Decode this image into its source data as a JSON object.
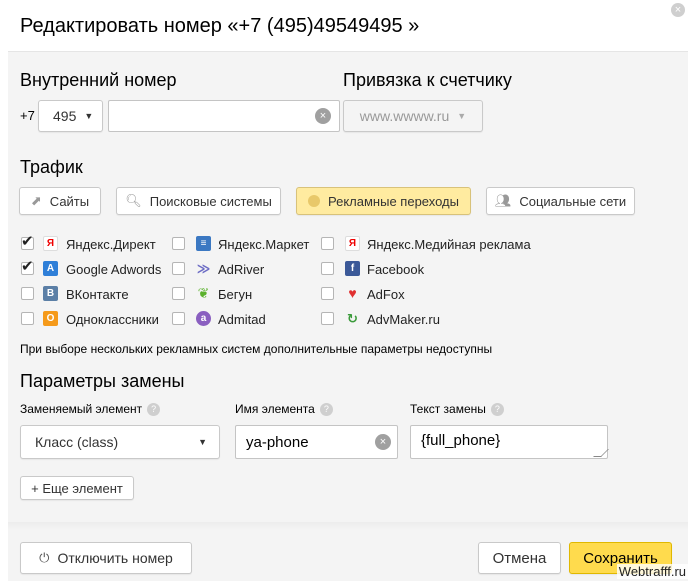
{
  "dialog": {
    "title": "Редактировать номер  «+7 (495)49549495 »",
    "close_icon": "×"
  },
  "internal_number": {
    "heading": "Внутренний номер",
    "country_code": "+7",
    "area_code": "495",
    "number_value": ""
  },
  "counter_binding": {
    "heading": "Привязка к счетчику",
    "site": "www.wwww.ru"
  },
  "traffic": {
    "heading": "Трафик",
    "buttons": [
      {
        "label": "Сайты",
        "icon": "arrow-icon"
      },
      {
        "label": "Поисковые системы",
        "icon": "search-icon"
      },
      {
        "label": "Рекламные переходы",
        "icon": "coin-icon"
      },
      {
        "label": "Социальные сети",
        "icon": "people-icon"
      }
    ],
    "active": "Рекламные переходы",
    "ad_systems": [
      {
        "label": "Яндекс.Директ",
        "checked": true,
        "icon": "yandex-icon",
        "color": "#ffffff"
      },
      {
        "label": "Google Adwords",
        "checked": true,
        "icon": "google-adwords-icon",
        "color": "#2f7fd8"
      },
      {
        "label": "ВКонтакте",
        "checked": false,
        "icon": "vk-icon",
        "color": "#5b7fa6"
      },
      {
        "label": "Одноклассники",
        "checked": false,
        "icon": "odnoklassniki-icon",
        "color": "#f59a1a"
      },
      {
        "label": "Яндекс.Маркет",
        "checked": false,
        "icon": "yandex-market-icon",
        "color": "#3b78c2"
      },
      {
        "label": "AdRiver",
        "checked": false,
        "icon": "adriver-icon",
        "color": "#6b6bc4"
      },
      {
        "label": "Бегун",
        "checked": false,
        "icon": "begun-icon",
        "color": "#5ab12c"
      },
      {
        "label": "Admitad",
        "checked": false,
        "icon": "admitad-icon",
        "color": "#8a5fc0"
      },
      {
        "label": "Яндекс.Медийная реклама",
        "checked": false,
        "icon": "yandex-media-icon",
        "color": "#ffffff"
      },
      {
        "label": "Facebook",
        "checked": false,
        "icon": "facebook-icon",
        "color": "#3b5998"
      },
      {
        "label": "AdFox",
        "checked": false,
        "icon": "adfox-icon",
        "color": "#e03030"
      },
      {
        "label": "AdvMaker.ru",
        "checked": false,
        "icon": "advmaker-icon",
        "color": "#3a9a3a"
      }
    ],
    "note": "При выборе нескольких рекламных систем дополнительные параметры недоступны"
  },
  "replacement": {
    "heading": "Параметры замены",
    "element_label": "Заменяемый элемент",
    "element_value": "Класс (class)",
    "name_label": "Имя элемента",
    "name_value": "ya-phone",
    "text_label": "Текст замены",
    "text_value": "{full_phone}",
    "add_button": "+ Еще элемент",
    "help_icon": "?"
  },
  "footer": {
    "disable_button": "Отключить номер",
    "cancel_button": "Отмена",
    "save_button": "Сохранить"
  },
  "watermark": "Webtrafff.ru"
}
